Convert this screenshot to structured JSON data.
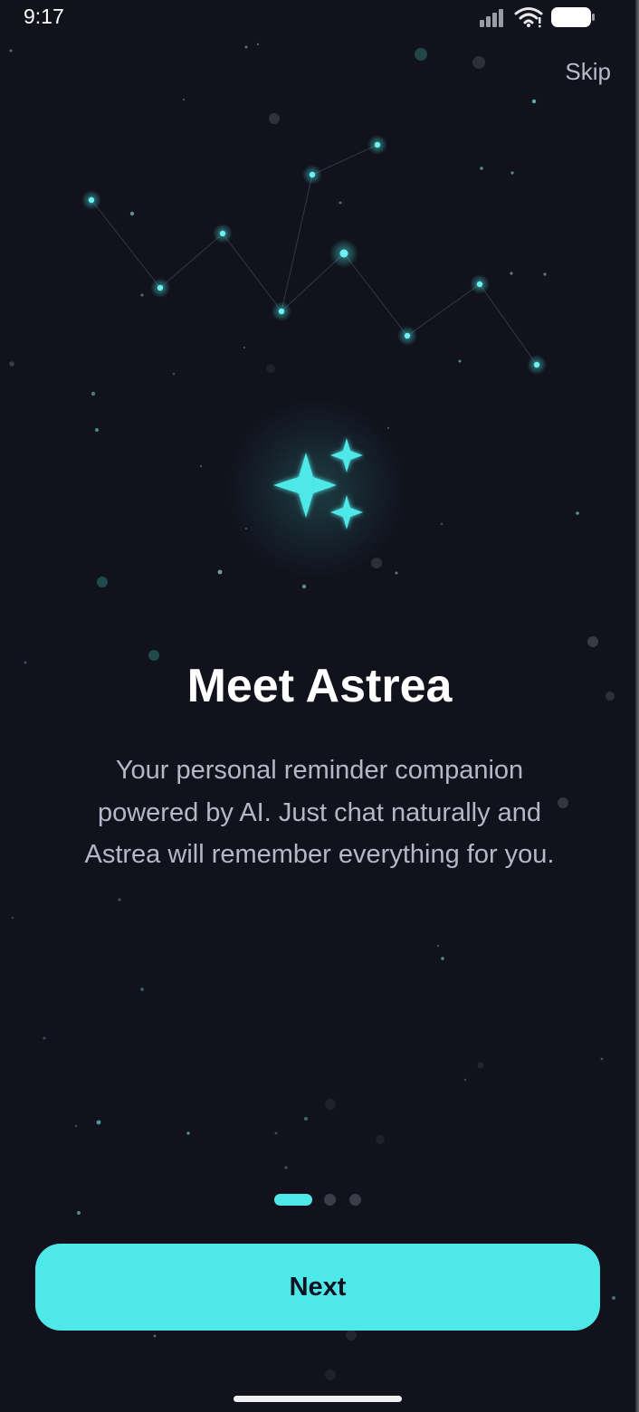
{
  "status_bar": {
    "time": "9:17",
    "icons": [
      "signal-icon",
      "wifi-icon",
      "battery-icon"
    ]
  },
  "skip_label": "Skip",
  "hero": {
    "icon": "sparkles-icon",
    "glow_color": "#4fe8e8"
  },
  "onboarding": {
    "title": "Meet Astrea",
    "description_lines": [
      "Your personal reminder companion",
      "powered by AI. Just chat naturally and",
      "Astrea will remember everything for you."
    ]
  },
  "pager": {
    "total_pages": 3,
    "active_page": 1
  },
  "next_label": "Next",
  "colors": {
    "background": "#11121c",
    "accent": "#4fe8e8",
    "text_primary": "#ffffff",
    "text_secondary": "#b6b7c6",
    "button_text": "#0d1320"
  }
}
